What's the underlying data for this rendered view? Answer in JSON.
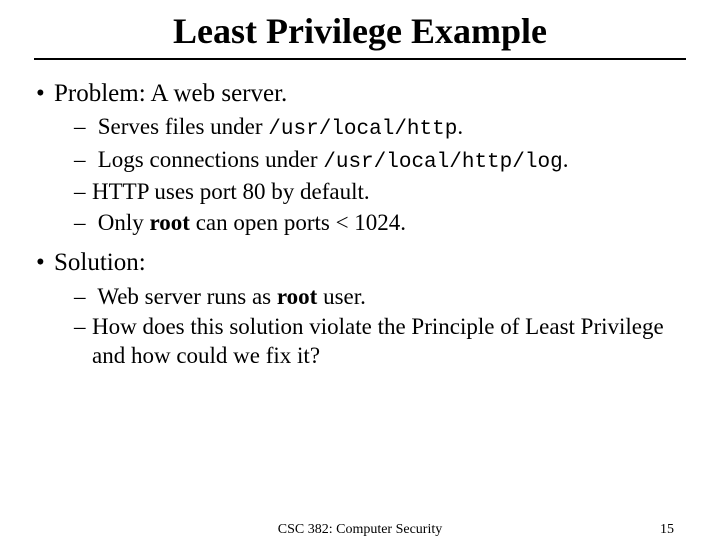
{
  "title": "Least Privilege Example",
  "b1": "Problem: A web server.",
  "b1_1_a": "Serves files under ",
  "b1_1_code": "/usr/local/http",
  "b1_1_b": ".",
  "b1_2_a": "Logs connections under ",
  "b1_2_code": "/usr/local/http/log",
  "b1_2_b": ".",
  "b1_3": "HTTP uses port 80 by default.",
  "b1_4_a": "Only ",
  "b1_4_bold": "root",
  "b1_4_b": " can open ports < 1024.",
  "b2": "Solution:",
  "b2_1_a": "Web server runs as ",
  "b2_1_bold": "root",
  "b2_1_b": " user.",
  "b2_2": "How does this solution violate the Principle of Least Privilege and how could we fix it?",
  "footer_center": "CSC 382: Computer Security",
  "footer_right": "15"
}
